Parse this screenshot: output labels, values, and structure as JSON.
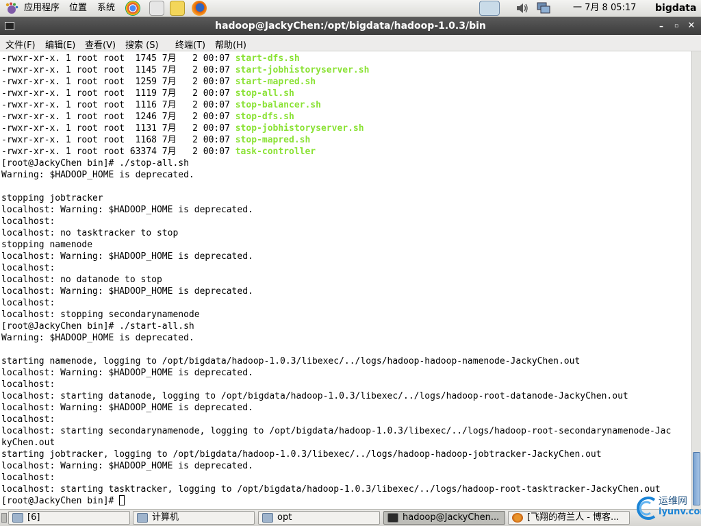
{
  "top_panel": {
    "apps_menu": "应用程序",
    "places_menu": "位置",
    "system_menu": "系统",
    "clock": "一 7月  8 05:17",
    "user": "bigdata"
  },
  "window": {
    "title": "hadoop@JackyChen:/opt/bigdata/hadoop-1.0.3/bin"
  },
  "menu": {
    "file": "文件(F)",
    "edit": "编辑(E)",
    "view": "查看(V)",
    "search": "搜索 (S)",
    "terminal": "终端(T)",
    "help": "帮助(H)"
  },
  "terminal": {
    "lines": [
      {
        "text": "-rwxr-xr-x. 1 root root  1745 7月   2 00:07 ",
        "highlight": "start-dfs.sh"
      },
      {
        "text": "-rwxr-xr-x. 1 root root  1145 7月   2 00:07 ",
        "highlight": "start-jobhistoryserver.sh"
      },
      {
        "text": "-rwxr-xr-x. 1 root root  1259 7月   2 00:07 ",
        "highlight": "start-mapred.sh"
      },
      {
        "text": "-rwxr-xr-x. 1 root root  1119 7月   2 00:07 ",
        "highlight": "stop-all.sh"
      },
      {
        "text": "-rwxr-xr-x. 1 root root  1116 7月   2 00:07 ",
        "highlight": "stop-balancer.sh"
      },
      {
        "text": "-rwxr-xr-x. 1 root root  1246 7月   2 00:07 ",
        "highlight": "stop-dfs.sh"
      },
      {
        "text": "-rwxr-xr-x. 1 root root  1131 7月   2 00:07 ",
        "highlight": "stop-jobhistoryserver.sh"
      },
      {
        "text": "-rwxr-xr-x. 1 root root  1168 7月   2 00:07 ",
        "highlight": "stop-mapred.sh"
      },
      {
        "text": "-rwxr-xr-x. 1 root root 63374 7月   2 00:07 ",
        "highlight": "task-controller"
      },
      {
        "text": "[root@JackyChen bin]# ./stop-all.sh"
      },
      {
        "text": "Warning: $HADOOP_HOME is deprecated."
      },
      {
        "text": ""
      },
      {
        "text": "stopping jobtracker"
      },
      {
        "text": "localhost: Warning: $HADOOP_HOME is deprecated."
      },
      {
        "text": "localhost:"
      },
      {
        "text": "localhost: no tasktracker to stop"
      },
      {
        "text": "stopping namenode"
      },
      {
        "text": "localhost: Warning: $HADOOP_HOME is deprecated."
      },
      {
        "text": "localhost:"
      },
      {
        "text": "localhost: no datanode to stop"
      },
      {
        "text": "localhost: Warning: $HADOOP_HOME is deprecated."
      },
      {
        "text": "localhost:"
      },
      {
        "text": "localhost: stopping secondarynamenode"
      },
      {
        "text": "[root@JackyChen bin]# ./start-all.sh"
      },
      {
        "text": "Warning: $HADOOP_HOME is deprecated."
      },
      {
        "text": ""
      },
      {
        "text": "starting namenode, logging to /opt/bigdata/hadoop-1.0.3/libexec/../logs/hadoop-hadoop-namenode-JackyChen.out"
      },
      {
        "text": "localhost: Warning: $HADOOP_HOME is deprecated."
      },
      {
        "text": "localhost:"
      },
      {
        "text": "localhost: starting datanode, logging to /opt/bigdata/hadoop-1.0.3/libexec/../logs/hadoop-root-datanode-JackyChen.out"
      },
      {
        "text": "localhost: Warning: $HADOOP_HOME is deprecated."
      },
      {
        "text": "localhost:"
      },
      {
        "text": "localhost: starting secondarynamenode, logging to /opt/bigdata/hadoop-1.0.3/libexec/../logs/hadoop-root-secondarynamenode-Jac"
      },
      {
        "text": "kyChen.out"
      },
      {
        "text": "starting jobtracker, logging to /opt/bigdata/hadoop-1.0.3/libexec/../logs/hadoop-hadoop-jobtracker-JackyChen.out"
      },
      {
        "text": "localhost: Warning: $HADOOP_HOME is deprecated."
      },
      {
        "text": "localhost:"
      },
      {
        "text": "localhost: starting tasktracker, logging to /opt/bigdata/hadoop-1.0.3/libexec/../logs/hadoop-root-tasktracker-JackyChen.out"
      },
      {
        "text": "[root@JackyChen bin]# ",
        "cursor": true
      }
    ]
  },
  "taskbar": {
    "items": [
      {
        "label": "[6]",
        "icon": "folder-icon",
        "active": false
      },
      {
        "label": "计算机",
        "icon": "folder-icon",
        "active": false
      },
      {
        "label": "opt",
        "icon": "folder-icon",
        "active": false
      },
      {
        "label": "hadoop@JackyChen...",
        "icon": "terminal-icon",
        "active": true
      },
      {
        "label": "[飞翔的荷兰人 - 博客...",
        "icon": "browser-icon",
        "active": false
      }
    ]
  },
  "watermark": {
    "cn": "运维网",
    "en": "iyunv.com"
  },
  "colors": {
    "highlight_green": "#8ae234",
    "title_bar": "#3c3c3c",
    "panel": "#dcdcd8"
  }
}
